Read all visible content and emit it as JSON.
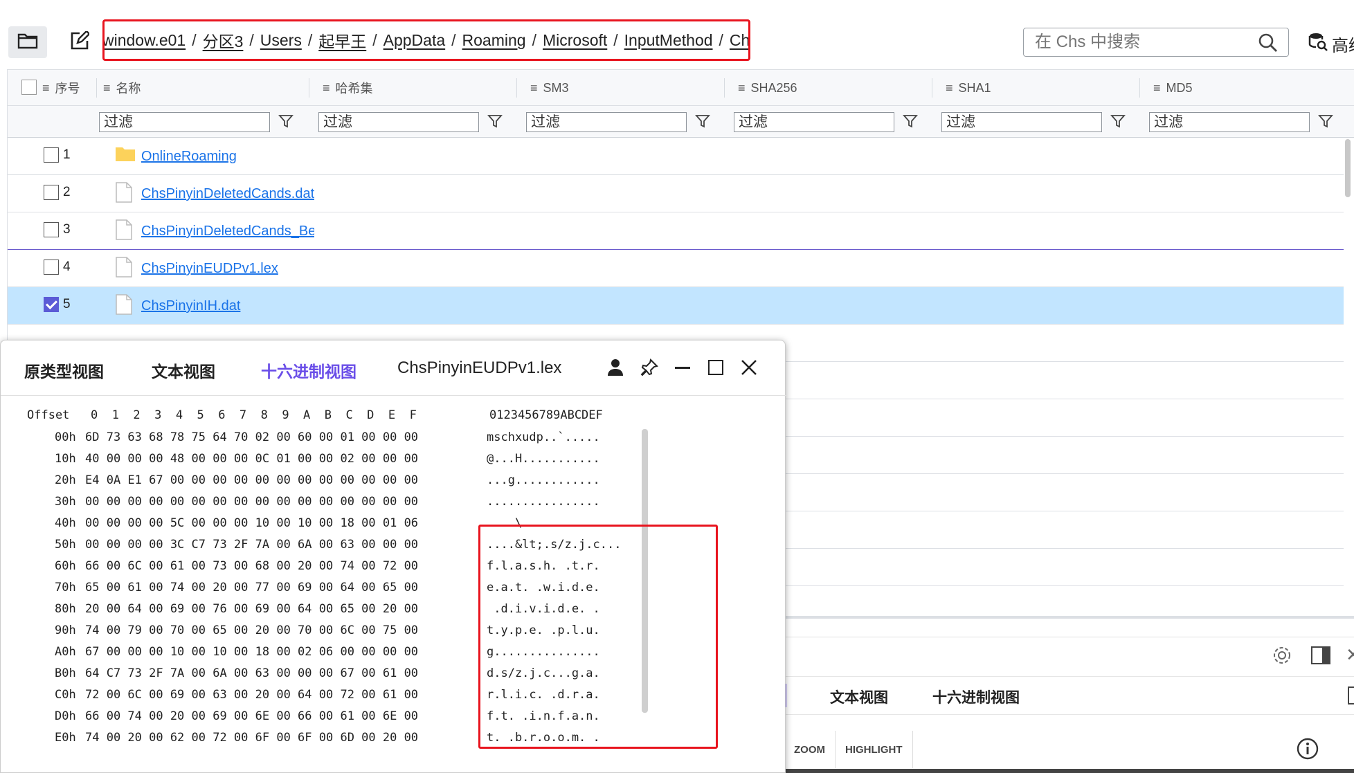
{
  "toolbar": {
    "breadcrumb": [
      "window.e01",
      "分区3",
      "Users",
      "起早王",
      "AppData",
      "Roaming",
      "Microsoft",
      "InputMethod",
      "Chs"
    ],
    "breadcrumb_sep": "/",
    "search_placeholder": "在 Chs 中搜索",
    "advanced_label": "高级"
  },
  "table": {
    "columns": [
      "序号",
      "名称",
      "哈希集",
      "SM3",
      "SHA256",
      "SHA1",
      "MD5"
    ],
    "filter_label": "过滤",
    "rows": [
      {
        "index": "1",
        "name": "OnlineRoaming",
        "type": "folder",
        "checked": false
      },
      {
        "index": "2",
        "name": "ChsPinyinDeletedCands.dat",
        "type": "file",
        "checked": false
      },
      {
        "index": "3",
        "name": "ChsPinyinDeletedCands_Be",
        "type": "file",
        "checked": false
      },
      {
        "index": "4",
        "name": "ChsPinyinEUDPv1.lex",
        "type": "file",
        "checked": false
      },
      {
        "index": "5",
        "name": "ChsPinyinIH.dat",
        "type": "file",
        "checked": true
      }
    ]
  },
  "hex_window": {
    "tabs": [
      "原类型视图",
      "文本视图",
      "十六进制视图"
    ],
    "active_tab": "十六进制视图",
    "title": "ChsPinyinEUDPv1.lex",
    "header_offset": "Offset",
    "header_cols": "0  1  2  3  4  5  6  7  8  9  A  B  C  D  E  F",
    "header_ascii": "0123456789ABCDEF",
    "lines": [
      {
        "off": "00h",
        "hex": "6D 73 63 68 78 75 64 70 02 00 60 00 01 00 00 00",
        "ascii": "mschxudp..`....."
      },
      {
        "off": "10h",
        "hex": "40 00 00 00 48 00 00 00 0C 01 00 00 02 00 00 00",
        "ascii": "@...H..........."
      },
      {
        "off": "20h",
        "hex": "E4 0A E1 67 00 00 00 00 00 00 00 00 00 00 00 00",
        "ascii": "...g............"
      },
      {
        "off": "30h",
        "hex": "00 00 00 00 00 00 00 00 00 00 00 00 00 00 00 00",
        "ascii": "................"
      },
      {
        "off": "40h",
        "hex": "00 00 00 00 5C 00 00 00 10 00 10 00 18 00 01 06",
        "ascii": "....\\..........."
      },
      {
        "off": "50h",
        "hex": "00 00 00 00 3C C7 73 2F 7A 00 6A 00 63 00 00 00",
        "ascii": "....&lt;.s/z.j.c..."
      },
      {
        "off": "60h",
        "hex": "66 00 6C 00 61 00 73 00 68 00 20 00 74 00 72 00",
        "ascii": "f.l.a.s.h. .t.r."
      },
      {
        "off": "70h",
        "hex": "65 00 61 00 74 00 20 00 77 00 69 00 64 00 65 00",
        "ascii": "e.a.t. .w.i.d.e."
      },
      {
        "off": "80h",
        "hex": "20 00 64 00 69 00 76 00 69 00 64 00 65 00 20 00",
        "ascii": " .d.i.v.i.d.e. ."
      },
      {
        "off": "90h",
        "hex": "74 00 79 00 70 00 65 00 20 00 70 00 6C 00 75 00",
        "ascii": "t.y.p.e. .p.l.u."
      },
      {
        "off": "A0h",
        "hex": "67 00 00 00 10 00 10 00 18 00 02 06 00 00 00 00",
        "ascii": "g..............."
      },
      {
        "off": "B0h",
        "hex": "64 C7 73 2F 7A 00 6A 00 63 00 00 00 67 00 61 00",
        "ascii": "d.s/z.j.c...g.a."
      },
      {
        "off": "C0h",
        "hex": "72 00 6C 00 69 00 63 00 20 00 64 00 72 00 61 00",
        "ascii": "r.l.i.c. .d.r.a."
      },
      {
        "off": "D0h",
        "hex": "66 00 74 00 20 00 69 00 6E 00 66 00 61 00 6E 00",
        "ascii": "f.t. .i.n.f.a.n."
      },
      {
        "off": "E0h",
        "hex": "74 00 20 00 62 00 72 00 6F 00 6F 00 6D 00 20 00",
        "ascii": "t. .b.r.o.o.m. ."
      }
    ]
  },
  "lower_panel": {
    "tabs": [
      "文本视图",
      "十六进制视图"
    ],
    "tools": [
      "ZOOM",
      "HIGHLIGHT"
    ]
  },
  "colors": {
    "accent": "#6a4ee8",
    "link": "#1a73e8",
    "selected_row": "#c2e5ff",
    "highlight_box": "#e8141e"
  }
}
